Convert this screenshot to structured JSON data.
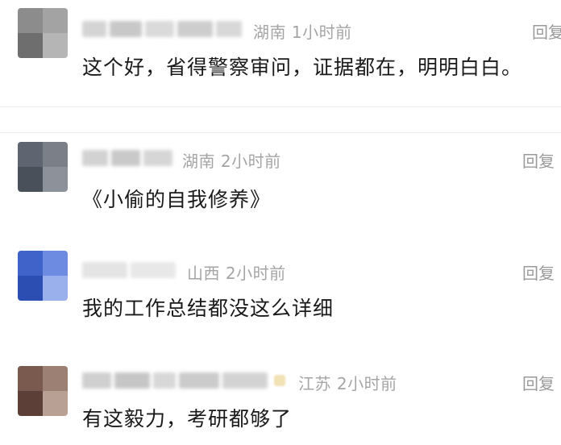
{
  "comments": [
    {
      "location_time": "湖南 1小时前",
      "reply_label": "回复",
      "text": "这个好，省得警察审问，证据都在，明明白白。",
      "avatar_colors": [
        "#8c8c8c",
        "#a3a3a3",
        "#6e6e6e",
        "#b5b5b5"
      ]
    },
    {
      "location_time": "湖南 2小时前",
      "reply_label": "回复",
      "text": "《小偷的自我修养》",
      "avatar_colors": [
        "#5e6470",
        "#7a7f88",
        "#4a505a",
        "#8d9199"
      ]
    },
    {
      "location_time": "山西 2小时前",
      "reply_label": "回复",
      "text": "我的工作总结都没这么详细",
      "avatar_colors": [
        "#3f63c9",
        "#6d8be0",
        "#2c4eb3",
        "#9ab0ec"
      ]
    },
    {
      "location_time": "江苏 2小时前",
      "reply_label": "回复",
      "text": "有这毅力，考研都够了",
      "avatar_colors": [
        "#7a5a4e",
        "#9c8074",
        "#5c4038",
        "#b8a095"
      ]
    }
  ]
}
